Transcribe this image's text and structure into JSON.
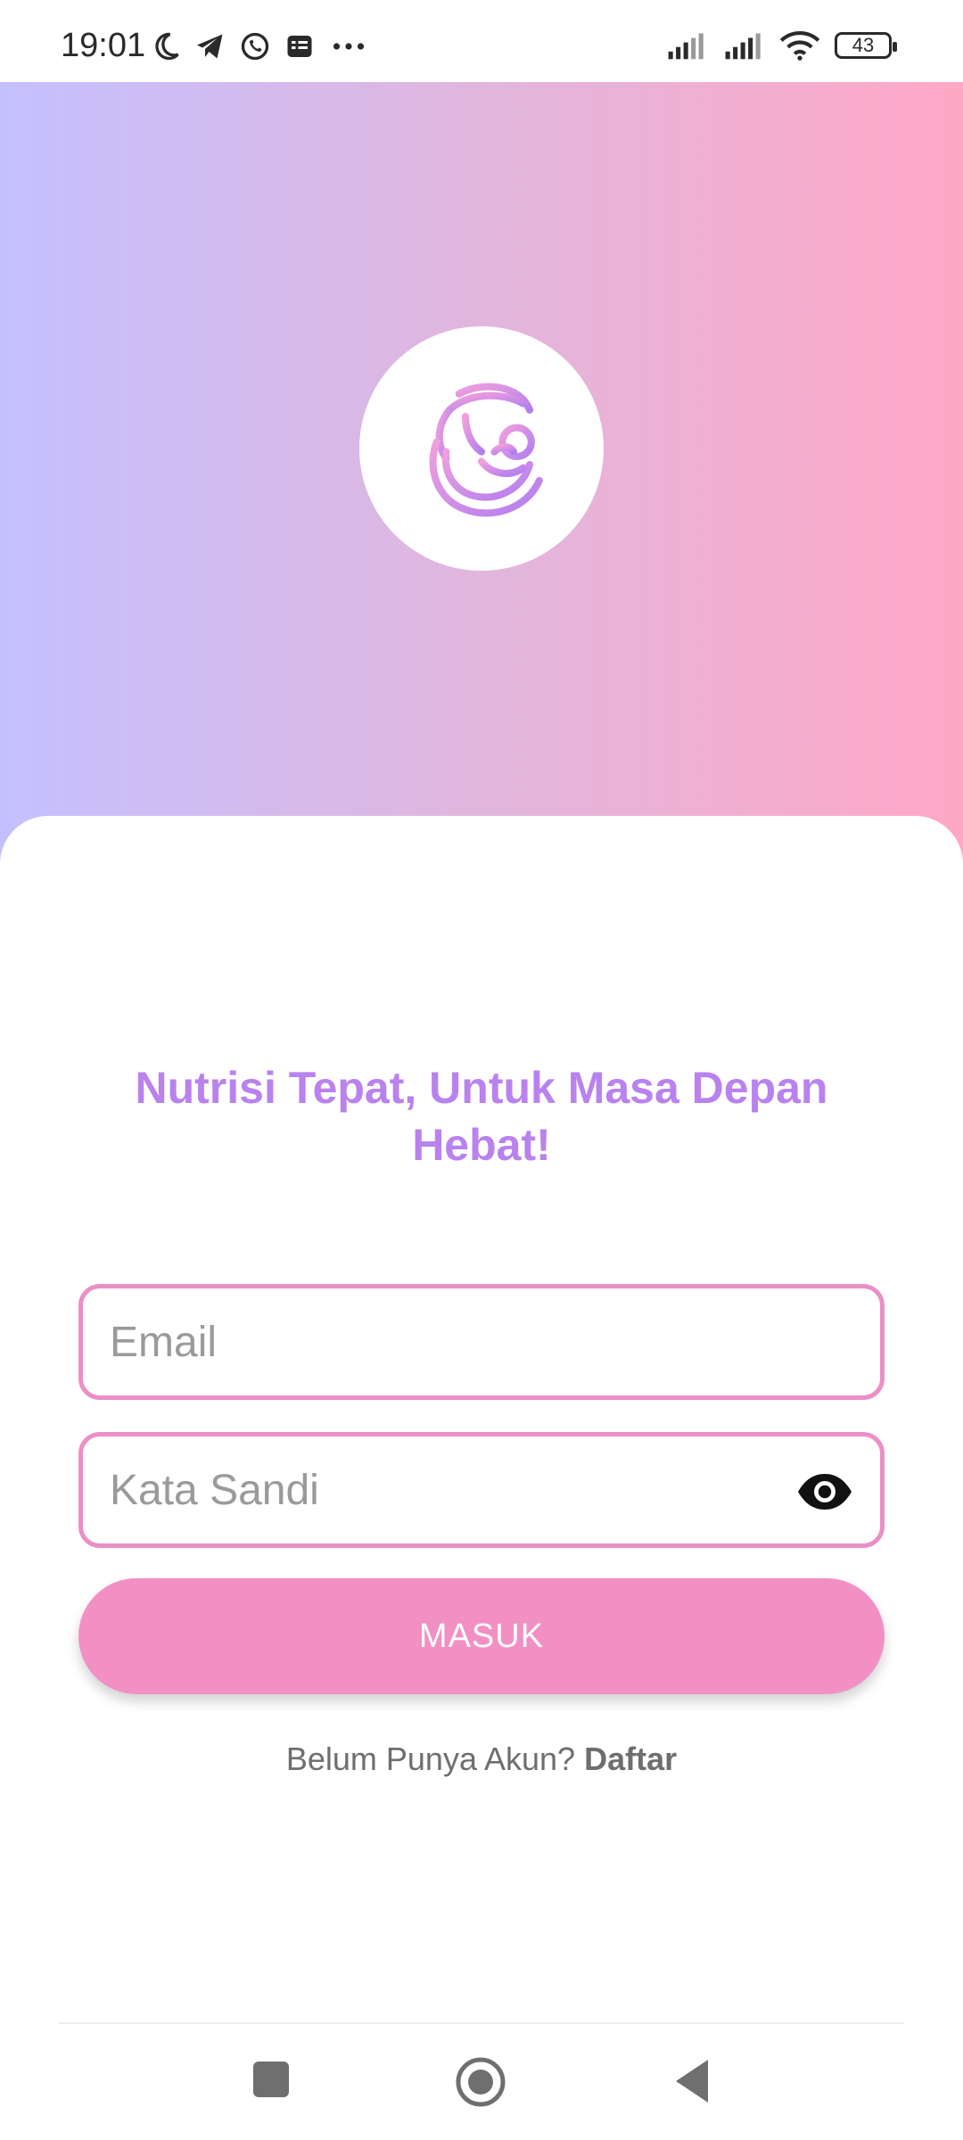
{
  "status_bar": {
    "time": "19:01",
    "battery": "43",
    "icons_left": [
      "moon-icon",
      "telegram-icon",
      "whatsapp-icon",
      "news-icon",
      "more-icon"
    ],
    "icons_right": [
      "signal-icon",
      "signal-icon",
      "wifi-icon",
      "battery-icon"
    ]
  },
  "hero": {
    "gradient_start": "#c4c0ff",
    "gradient_end": "#ffa8c6",
    "logo_icon": "mother-baby-icon"
  },
  "content": {
    "tagline": "Nutrisi Tepat, Untuk Masa Depan Hebat!"
  },
  "form": {
    "email_placeholder": "Email",
    "password_placeholder": "Kata Sandi",
    "submit_label": "MASUK",
    "accent_color": "#f290c4"
  },
  "register": {
    "prompt": "Belum Punya Akun?",
    "link": "Daftar"
  },
  "nav": {
    "items": [
      "recents-button",
      "home-button",
      "back-button"
    ]
  }
}
